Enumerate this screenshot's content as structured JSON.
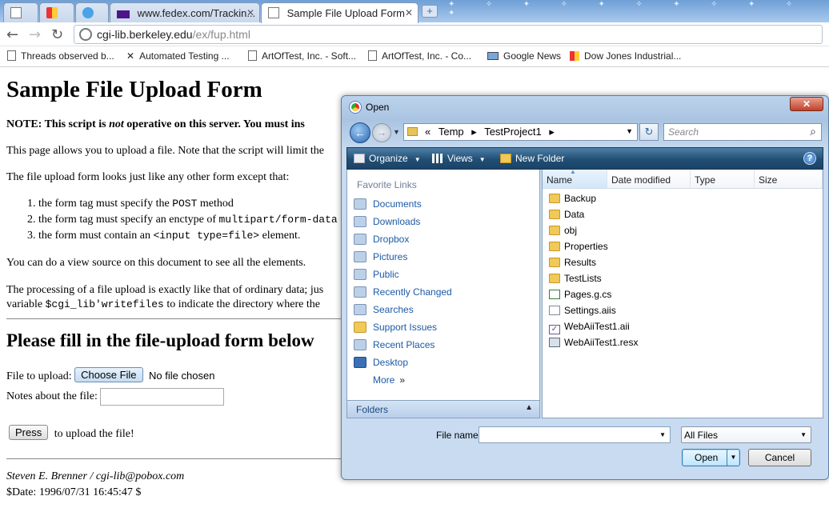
{
  "browser": {
    "tabs": [
      {
        "label": ""
      },
      {
        "label": ""
      },
      {
        "label": ""
      },
      {
        "label": "www.fedex.com/Trackin..."
      },
      {
        "label": "Sample File Upload Form"
      }
    ],
    "url_host": "cgi-lib.berkeley.edu",
    "url_path": "/ex/fup.html",
    "bookmarks": [
      {
        "label": "Threads observed b..."
      },
      {
        "label": "Automated Testing ..."
      },
      {
        "label": "ArtOfTest, Inc. - Soft..."
      },
      {
        "label": "ArtOfTest, Inc. - Co..."
      },
      {
        "label": "Google News"
      },
      {
        "label": "Dow Jones Industrial..."
      }
    ]
  },
  "page": {
    "title": "Sample File Upload Form",
    "note_prefix": "NOTE: This script is ",
    "note_em": "not",
    "note_suffix": " operative on this server. You must ins",
    "para1": "This page allows you to upload a file. Note that the script will limit the",
    "para2": "The file upload form looks just like any other form except that:",
    "list": [
      {
        "pre": "the form tag must specify the ",
        "code": "POST",
        "post": " method"
      },
      {
        "pre": "the form tag must specify an enctype of ",
        "code": "multipart/form-data",
        "post": ""
      },
      {
        "pre": "the form must contain an ",
        "code": "<input type=file>",
        "post": " element."
      }
    ],
    "para3": "You can do a view source on this document to see all the elements.",
    "para4": "The processing of a file upload is exactly like that of ordinary data; jus",
    "para5_pre": "variable ",
    "para5_code": "$cgi_lib'writefiles",
    "para5_post": " to indicate the directory where the",
    "form_heading": "Please fill in the file-upload form below",
    "file_label": "File to upload:",
    "choose_label": "Choose File",
    "no_file": "No file chosen",
    "notes_label": "Notes about the file:",
    "press_label": "Press",
    "press_suffix": "to upload the file!",
    "footer_author": "Steven E. Brenner / cgi-lib@pobox.com",
    "footer_date": "$Date: 1996/07/31 16:45:47 $"
  },
  "dialog": {
    "title": "Open",
    "path_chevrons": "«",
    "path_part1": "Temp",
    "path_part2": "TestProject1",
    "search_placeholder": "Search",
    "commands": {
      "organize": "Organize",
      "views": "Views",
      "new_folder": "New Folder"
    },
    "favorites_heading": "Favorite Links",
    "nav_items": [
      {
        "label": "Documents"
      },
      {
        "label": "Downloads"
      },
      {
        "label": "Dropbox"
      },
      {
        "label": "Pictures"
      },
      {
        "label": "Public"
      },
      {
        "label": "Recently Changed"
      },
      {
        "label": "Searches"
      },
      {
        "label": "Support Issues"
      },
      {
        "label": "Recent Places"
      },
      {
        "label": "Desktop"
      },
      {
        "label": "More"
      }
    ],
    "folders_label": "Folders",
    "columns": {
      "name": "Name",
      "date": "Date modified",
      "type": "Type",
      "size": "Size"
    },
    "files": [
      {
        "name": "Backup",
        "kind": "folder"
      },
      {
        "name": "Data",
        "kind": "folder"
      },
      {
        "name": "obj",
        "kind": "folder"
      },
      {
        "name": "Properties",
        "kind": "folder"
      },
      {
        "name": "Results",
        "kind": "folder"
      },
      {
        "name": "TestLists",
        "kind": "folder"
      },
      {
        "name": "Pages.g.cs",
        "kind": "cs"
      },
      {
        "name": "Settings.aiis",
        "kind": "doc"
      },
      {
        "name": "WebAiiTest1.aii",
        "kind": "aii"
      },
      {
        "name": "WebAiiTest1.resx",
        "kind": "resx"
      }
    ],
    "filename_label": "File name:",
    "filename_value": "",
    "filter_value": "All Files",
    "open_label": "Open",
    "cancel_label": "Cancel"
  }
}
